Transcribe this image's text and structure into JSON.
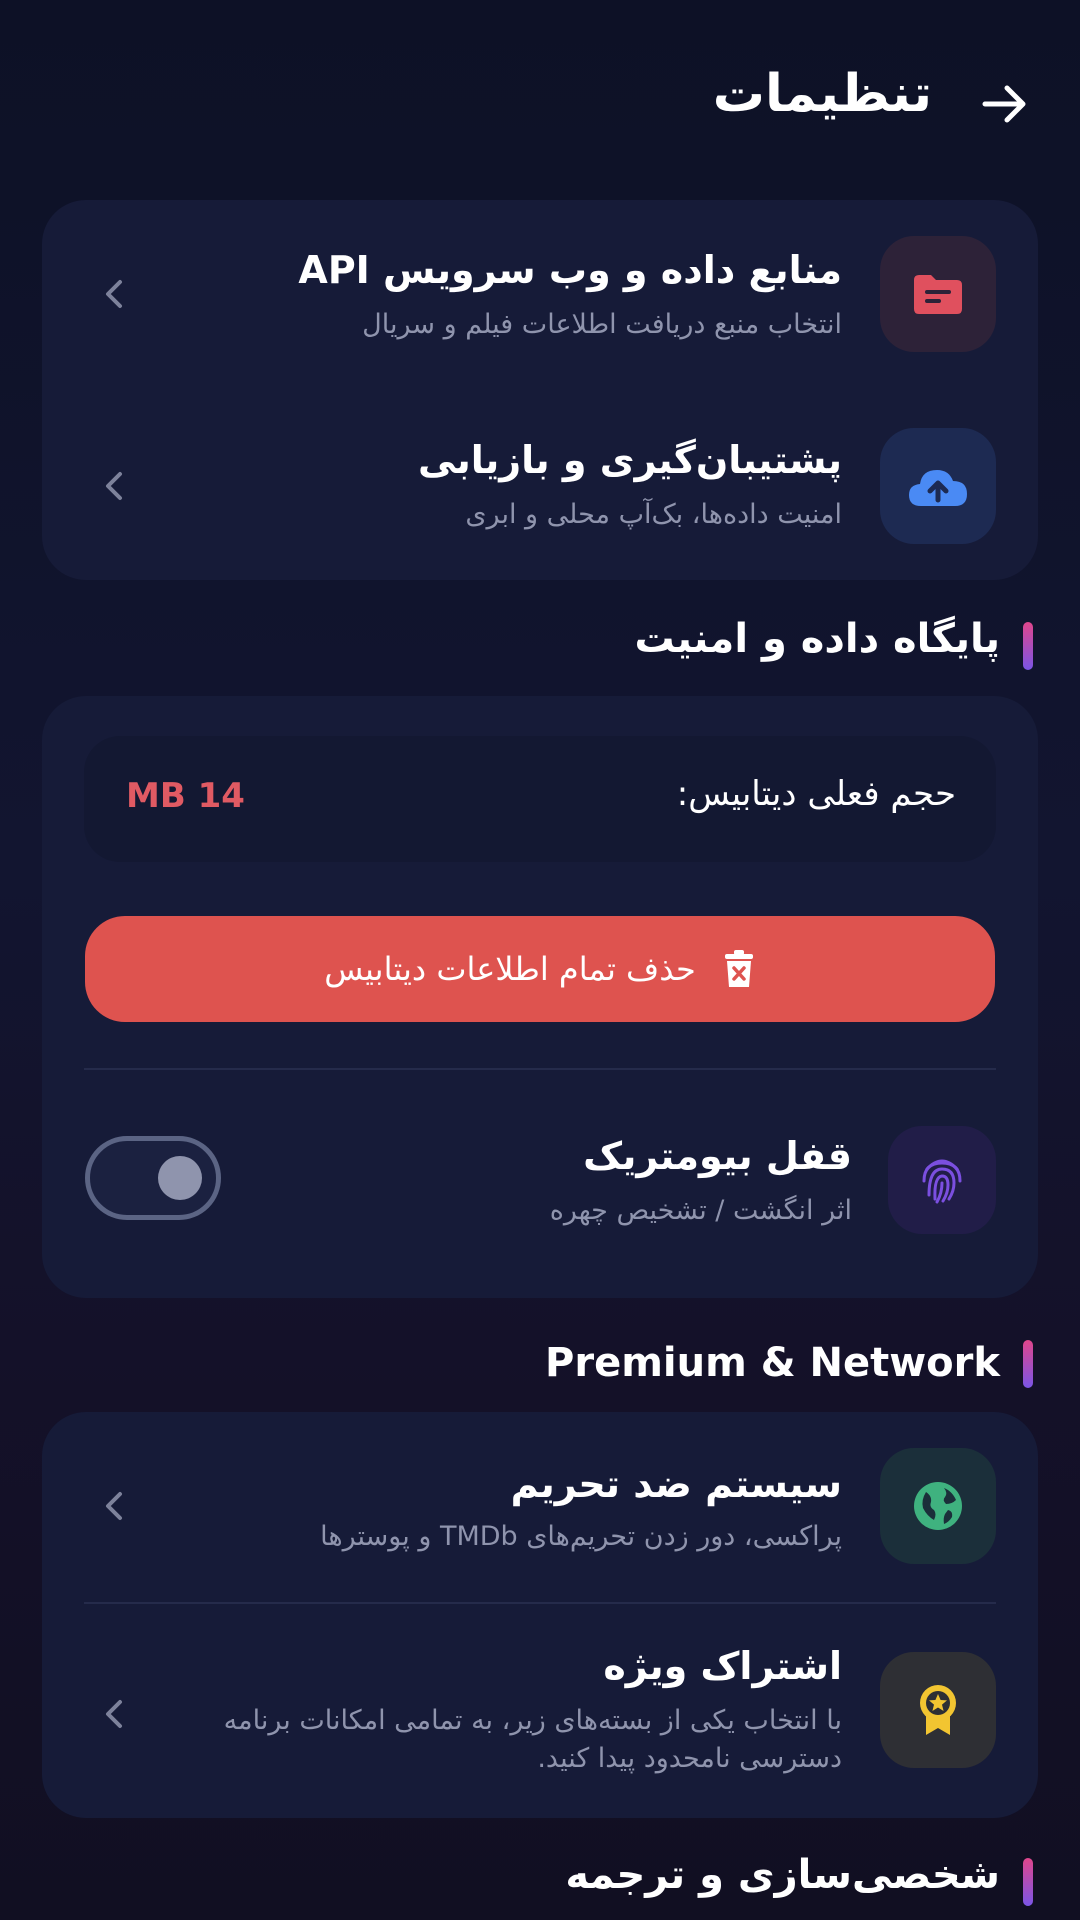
{
  "header": {
    "title": "تنظیمات",
    "back_icon": "arrow-right-icon"
  },
  "top_card": {
    "items": [
      {
        "title": "منابع داده و وب سرویس API",
        "subtitle": "انتخاب منبع دریافت اطلاعات فیلم و سریال",
        "icon": "folder-icon",
        "icon_color": "#e0505e",
        "icon_bg": "#2d2238"
      },
      {
        "title": "پشتیبان‌گیری و بازیابی",
        "subtitle": "امنیت داده‌ها، بک‌آپ محلی و ابری",
        "icon": "cloud-upload-icon",
        "icon_color": "#4a8af4",
        "icon_bg": "#1d2a52"
      }
    ]
  },
  "database_section": {
    "title": "پایگاه داده و امنیت",
    "db_size_label": "حجم فعلی دیتابیس:",
    "db_size_value": "MB 14",
    "delete_button_label": "حذف تمام اطلاعات دیتابیس",
    "biometric": {
      "title": "قفل بیومتریک",
      "subtitle": "اثر انگشت / تشخیص چهره",
      "icon": "fingerprint-icon",
      "icon_color": "#7b4fe0",
      "enabled": false
    }
  },
  "premium_section": {
    "title": "Premium & Network",
    "items": [
      {
        "title": "سیستم ضد تحریم",
        "subtitle": "پراکسی، دور زدن تحریم‌های TMDb و پوسترها",
        "icon": "globe-icon",
        "icon_color": "#3fb27f",
        "icon_bg": "#1b2f3a"
      },
      {
        "title": "اشتراک ویژه",
        "subtitle": "با انتخاب یکی از بسته‌های زیر، به تمامی امکانات برنامه دسترسی نامحدود پیدا کنید.",
        "icon": "award-badge-icon",
        "icon_color": "#f2c531",
        "icon_bg": "#2e2f34"
      }
    ]
  },
  "personalization_section": {
    "title": "شخصی‌سازی و ترجمه"
  },
  "colors": {
    "background": "#0d1126",
    "card": "#161b38",
    "danger": "#de534f",
    "accent_gradient": [
      "#e0468c",
      "#7b55e6"
    ]
  }
}
